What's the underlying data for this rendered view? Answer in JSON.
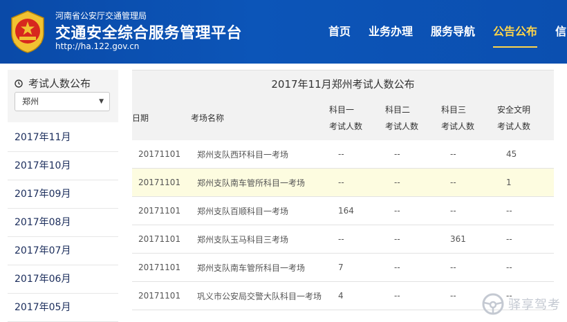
{
  "header": {
    "org_name": "河南省公安厅交通管理局",
    "title": "交通安全综合服务管理平台",
    "url": "http://ha.122.gov.cn",
    "nav": [
      "首页",
      "业务办理",
      "服务导航",
      "公告公布",
      "信"
    ],
    "active_nav_index": 3
  },
  "sidebar": {
    "title": "考试人数公布",
    "city_select": {
      "value": "郑州"
    },
    "months": [
      "2017年11月",
      "2017年10月",
      "2017年09月",
      "2017年08月",
      "2017年07月",
      "2017年06月",
      "2017年05月"
    ]
  },
  "table": {
    "title": "2017年11月郑州考试人数公布",
    "headers": {
      "date": "日期",
      "site": "考场名称",
      "subject1": [
        "科目一",
        "考试人数"
      ],
      "subject2": [
        "科目二",
        "考试人数"
      ],
      "subject3": [
        "科目三",
        "考试人数"
      ],
      "safety": [
        "安全文明",
        "考试人数"
      ]
    },
    "rows": [
      [
        "20171101",
        "郑州支队西环科目一考场",
        "--",
        "--",
        "--",
        "45"
      ],
      [
        "20171101",
        "郑州支队南车管所科目一考场",
        "--",
        "--",
        "--",
        "1"
      ],
      [
        "20171101",
        "郑州支队百顺科目一考场",
        "164",
        "--",
        "--",
        "--"
      ],
      [
        "20171101",
        "郑州支队玉马科目三考场",
        "--",
        "--",
        "361",
        "--"
      ],
      [
        "20171101",
        "郑州支队南车管所科目一考场",
        "7",
        "--",
        "--",
        "--"
      ],
      [
        "20171101",
        "巩义市公安局交警大队科目一考场",
        "4",
        "--",
        "--",
        "--"
      ]
    ],
    "highlight_row_index": 1
  },
  "watermark": {
    "text": "驿享驾考"
  },
  "colors": {
    "header_blue": "#0b4fb0",
    "active_nav": "#ffd54a",
    "highlight_row": "#fdfce0"
  }
}
